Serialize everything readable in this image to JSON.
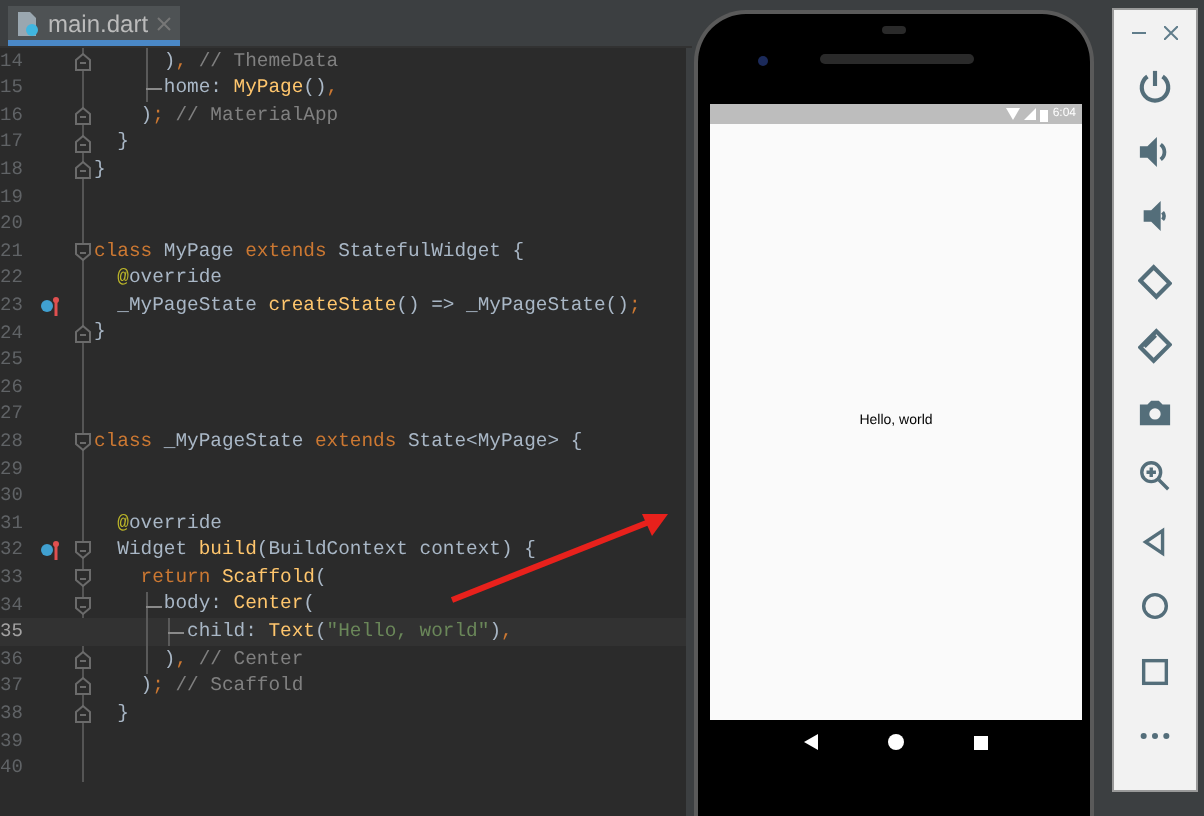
{
  "tab": {
    "label": "main.dart",
    "selected": true
  },
  "code_lines": [
    {
      "number": "14",
      "fold_end": true,
      "tokens": [
        {
          "kind": "indent"
        },
        {
          "kind": "indent"
        },
        {
          "kind": "bar"
        },
        {
          "kind": "plain",
          "text": ")"
        },
        {
          "kind": "punct",
          "text": ","
        },
        {
          "kind": "comment",
          "text": " // ThemeData"
        }
      ]
    },
    {
      "number": "15",
      "tokens": [
        {
          "kind": "indent"
        },
        {
          "kind": "indent"
        },
        {
          "kind": "branch"
        },
        {
          "kind": "plain",
          "text": "home: "
        },
        {
          "kind": "type",
          "text": "MyPage"
        },
        {
          "kind": "plain",
          "text": "()"
        },
        {
          "kind": "punct",
          "text": ","
        }
      ]
    },
    {
      "number": "16",
      "fold_end": true,
      "tokens": [
        {
          "kind": "indent"
        },
        {
          "kind": "indent"
        },
        {
          "kind": "plain",
          "text": ")"
        },
        {
          "kind": "punct",
          "text": ";"
        },
        {
          "kind": "comment",
          "text": " // MaterialApp"
        }
      ]
    },
    {
      "number": "17",
      "fold_end": true,
      "tokens": [
        {
          "kind": "indent"
        },
        {
          "kind": "plain",
          "text": "}"
        }
      ]
    },
    {
      "number": "18",
      "fold_end": true,
      "tokens": [
        {
          "kind": "plain",
          "text": "}"
        }
      ]
    },
    {
      "number": "19"
    },
    {
      "number": "20"
    },
    {
      "number": "21",
      "fold_start": true,
      "tokens": [
        {
          "kind": "keyword",
          "text": "class"
        },
        {
          "kind": "plain",
          "text": " MyPage "
        },
        {
          "kind": "keyword",
          "text": "extends"
        },
        {
          "kind": "plain",
          "text": " StatefulWidget {"
        }
      ]
    },
    {
      "number": "22",
      "tokens": [
        {
          "kind": "indent"
        },
        {
          "kind": "annotation",
          "text": "@"
        },
        {
          "kind": "plain",
          "text": "override"
        }
      ]
    },
    {
      "number": "23",
      "override_marker": true,
      "tokens": [
        {
          "kind": "indent"
        },
        {
          "kind": "plain",
          "text": "_MyPageState "
        },
        {
          "kind": "function",
          "text": "createState"
        },
        {
          "kind": "plain",
          "text": "() => _MyPageState()"
        },
        {
          "kind": "punct",
          "text": ";"
        }
      ]
    },
    {
      "number": "24",
      "fold_end": true,
      "tokens": [
        {
          "kind": "plain",
          "text": "}"
        }
      ]
    },
    {
      "number": "25"
    },
    {
      "number": "26"
    },
    {
      "number": "27"
    },
    {
      "number": "28",
      "fold_start": true,
      "tokens": [
        {
          "kind": "keyword",
          "text": "class"
        },
        {
          "kind": "plain",
          "text": " _MyPageState "
        },
        {
          "kind": "keyword",
          "text": "extends"
        },
        {
          "kind": "plain",
          "text": " State<MyPage> {"
        }
      ]
    },
    {
      "number": "29"
    },
    {
      "number": "30"
    },
    {
      "number": "31",
      "tokens": [
        {
          "kind": "indent"
        },
        {
          "kind": "annotation",
          "text": "@"
        },
        {
          "kind": "plain",
          "text": "override"
        }
      ]
    },
    {
      "number": "32",
      "fold_start": true,
      "override_marker": true,
      "tokens": [
        {
          "kind": "indent"
        },
        {
          "kind": "plain",
          "text": "Widget "
        },
        {
          "kind": "function",
          "text": "build"
        },
        {
          "kind": "plain",
          "text": "(BuildContext context) {"
        }
      ]
    },
    {
      "number": "33",
      "fold_start": true,
      "tokens": [
        {
          "kind": "indent"
        },
        {
          "kind": "indent"
        },
        {
          "kind": "keyword",
          "text": "return "
        },
        {
          "kind": "function",
          "text": "Scaffold"
        },
        {
          "kind": "plain",
          "text": "("
        }
      ]
    },
    {
      "number": "34",
      "fold_start": true,
      "tokens": [
        {
          "kind": "indent"
        },
        {
          "kind": "indent"
        },
        {
          "kind": "branch"
        },
        {
          "kind": "plain",
          "text": "body: "
        },
        {
          "kind": "function",
          "text": "Center"
        },
        {
          "kind": "plain",
          "text": "("
        }
      ]
    },
    {
      "number": "35",
      "current": true,
      "tokens": [
        {
          "kind": "indent"
        },
        {
          "kind": "indent"
        },
        {
          "kind": "bar"
        },
        {
          "kind": "branch"
        },
        {
          "kind": "plain",
          "text": "child: "
        },
        {
          "kind": "function",
          "text": "Text"
        },
        {
          "kind": "plain",
          "text": "("
        },
        {
          "kind": "string",
          "text": "\"Hello, world\""
        },
        {
          "kind": "plain",
          "text": ")"
        },
        {
          "kind": "punct",
          "text": ","
        }
      ]
    },
    {
      "number": "36",
      "fold_end": true,
      "tokens": [
        {
          "kind": "indent"
        },
        {
          "kind": "indent"
        },
        {
          "kind": "bar"
        },
        {
          "kind": "plain",
          "text": ")"
        },
        {
          "kind": "punct",
          "text": ","
        },
        {
          "kind": "comment",
          "text": " // Center"
        }
      ]
    },
    {
      "number": "37",
      "fold_end": true,
      "tokens": [
        {
          "kind": "indent"
        },
        {
          "kind": "indent"
        },
        {
          "kind": "plain",
          "text": ")"
        },
        {
          "kind": "punct",
          "text": ";"
        },
        {
          "kind": "comment",
          "text": " // Scaffold"
        }
      ]
    },
    {
      "number": "38",
      "fold_end": true,
      "tokens": [
        {
          "kind": "indent"
        },
        {
          "kind": "plain",
          "text": "}"
        }
      ]
    },
    {
      "number": "39"
    },
    {
      "number": "40"
    }
  ],
  "phone": {
    "status_time": "6:04",
    "screen_text": "Hello, world"
  }
}
